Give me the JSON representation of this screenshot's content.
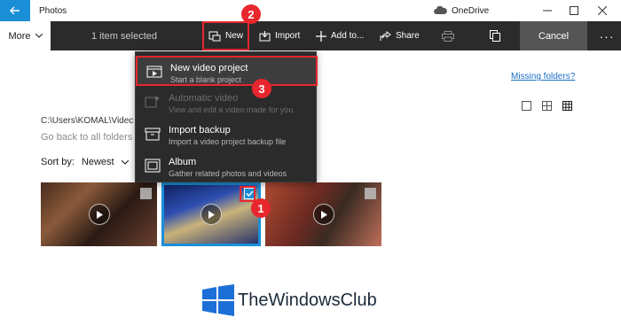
{
  "window": {
    "title": "Photos",
    "onedrive_label": "OneDrive"
  },
  "toolbar": {
    "more_label": "More",
    "selection_text": "1 item selected",
    "new_label": "New",
    "import_label": "Import",
    "add_to_label": "Add to...",
    "share_label": "Share",
    "cancel_label": "Cancel",
    "more_dots": "···"
  },
  "content": {
    "missing_folders": "Missing folders?",
    "path": "C:\\Users\\KOMAL\\Videc",
    "go_back": "Go back to all folders",
    "sort_label": "Sort by:",
    "sort_value": "Newest"
  },
  "menu": {
    "items": [
      {
        "title": "New video project",
        "subtitle": "Start a blank project"
      },
      {
        "title": "Automatic video",
        "subtitle": "View and edit a video made for you"
      },
      {
        "title": "Import backup",
        "subtitle": "Import a video project backup file"
      },
      {
        "title": "Album",
        "subtitle": "Gather related photos and videos"
      }
    ]
  },
  "callouts": {
    "one": "1",
    "two": "2",
    "three": "3"
  },
  "watermark": {
    "text": "TheWindowsClub"
  },
  "colors": {
    "accent": "#1a8fd8",
    "callout": "#e8262d",
    "toolbar": "#2b2b2b"
  }
}
